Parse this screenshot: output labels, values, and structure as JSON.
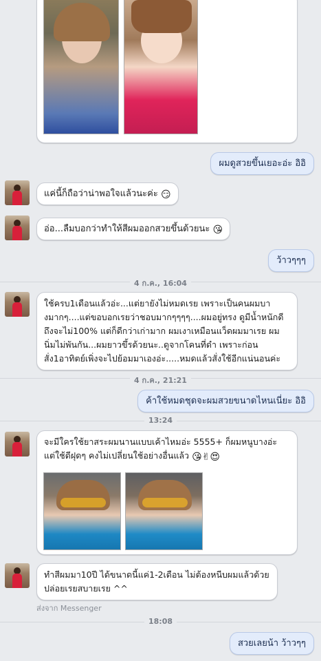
{
  "messages": {
    "m1": "ผมดูสวยขึ้นเยอะอ่ะ อิอิ",
    "m2": "แค่นี้ก็ถือว่าน่าพอใจแล้วนะค่ะ",
    "m3": "อ่อ...ลืมบอกว่าทำให้สีผมออกสวยขึ้นด้วยนะ",
    "m4": "ว้าวๆๆๆ",
    "m5": "ใช้ครบ1เดือนแล้วอ่ะ...แต่ยายังไม่หมดเรย เพราะเป็นคนผมบางมากๆ....แต่ขอบอกเรยว่าชอบมากๆๆๆๆ....ผมอยู่ทรง ดูมีน้ำหนักดีถึงจะไม่100% แต่ก็ดีกว่าเก่ามาก ผมเงาเหมือนแว็ดผมมาเรย ผมนิ่มไม่พันกัน...ผมยาวขึ้รด้วยนะ..ดูจากโคนที่ดำ เพราะก่อนสั่ง1อาทิตย์เพิ่งจะไปย้อมมาเองอ่ะ.....หมดแล้วสั่งใช้อีกแน่นอนค่ะ",
    "m6": "ค้าใช้หมดชุดจะผมสวยขนาดไหนเนี่ยะ อิอิ",
    "m7": "จะมีใครใช้ยาสระผมนานแบบเค้าไหมอ่ะ 5555+ ก็ผมหนูบางอ่ะ แต่ใช้ดีฝุดๆ คงไม่เปลี่ยนใช้อย่างอื่นแล้ว",
    "m8": "ทำสีผมมา10ปี ได้ขนาดนี้แค่1-2เดือน ไม่ต้องหนีบผมแล้วด้วย ปล่อยเรยสบายเรย ^^",
    "m9": "สวยเลยน้า ว้าวๆๆ"
  },
  "emoji": {
    "smirk": "😏",
    "kiss": "😘",
    "victory": "✌",
    "hearteyes": "😍"
  },
  "timestamps": {
    "t1": "4 ก.ค., 16:04",
    "t2": "4 ก.ค., 21:21",
    "t3": "13:24",
    "t4": "18:08"
  },
  "via_label": "ส่งจาก Messenger",
  "colors": {
    "background": "#e9ebee",
    "incoming_bubble": "#ffffff",
    "outgoing_bubble": "#e3ecfb"
  }
}
